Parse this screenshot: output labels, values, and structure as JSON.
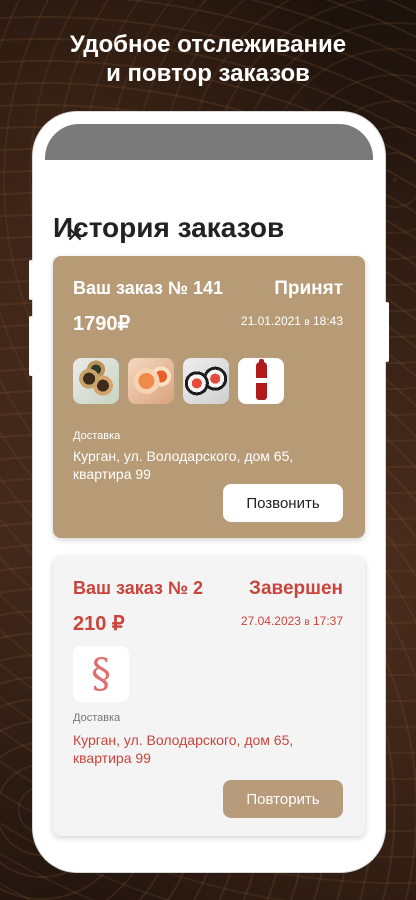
{
  "promo": {
    "headline_line1": "Удобное отслеживание",
    "headline_line2": "и повтор заказов"
  },
  "screen": {
    "close_icon": "close-icon",
    "title": "История заказов"
  },
  "orders": [
    {
      "title": "Ваш заказ № 141",
      "status": "Принят",
      "price": "1790₽",
      "date": "21.01.2021",
      "time_prefix": "в",
      "time": "18:43",
      "items": [
        "sushi-roll-image",
        "salmon-roll-image",
        "maki-set-image",
        "cola-bottle-image"
      ],
      "delivery_label": "Доставка",
      "address": "Курган, ул. Володарского, дом 65, квартира 99",
      "button": "Позвонить",
      "accent_color": "#b79a76"
    },
    {
      "title": "Ваш заказ № 2",
      "status": "Завершен",
      "price": "210 ₽",
      "date": "27.04.2023",
      "time_prefix": "в",
      "time": "17:37",
      "items": [
        "dragon-logo-image"
      ],
      "delivery_label": "Доставка",
      "address": "Курган, ул. Володарского, дом 65, квартира 99",
      "button": "Повторить",
      "accent_color": "#c9453c"
    }
  ]
}
